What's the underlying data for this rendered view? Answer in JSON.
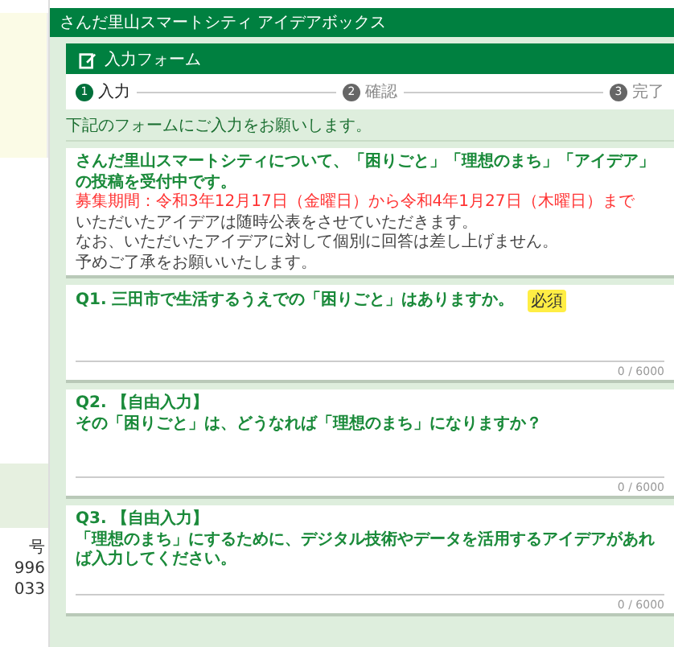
{
  "background_page": {
    "fragments": [
      "号",
      "996",
      "033"
    ]
  },
  "top_bar": {
    "title": "さんだ里山スマートシティ アイデアボックス"
  },
  "form": {
    "title": "入力フォーム",
    "steps": [
      {
        "number": "1",
        "label": "入力",
        "selected": true
      },
      {
        "number": "2",
        "label": "確認",
        "selected": false
      },
      {
        "number": "3",
        "label": "完了",
        "selected": false
      }
    ],
    "notice": "下記のフォームにご入力をお願いします。",
    "intro": {
      "heading": "さんだ里山スマートシティについて、「困りごと」「理想のまち」「アイデア」の投稿を受付中です。",
      "period": "募集期間：令和3年12月17日（金曜日）から令和4年1月27日（木曜日）まで",
      "lines": [
        "いただいたアイデアは随時公表をさせていただきます。",
        "なお、いただいたアイデアに対して個別に回答は差し上げません。",
        "予めご了承をお願いいたします。"
      ]
    },
    "questions": [
      {
        "number": "Q1.",
        "text": "三田市で生活するうえでの「困りごと」はありますか。",
        "badge": "必須",
        "counter": "0 / 6000"
      },
      {
        "number": "Q2.",
        "tag": "【自由入力】",
        "text": "その「困りごと」は、どうなれば「理想のまち」になりますか？",
        "counter": "0 / 6000"
      },
      {
        "number": "Q3.",
        "tag": "【自由入力】",
        "text": "「理想のまち」にするために、デジタル技術やデータを活用するアイデアがあれば入力してください。",
        "counter": "0 / 6000"
      }
    ]
  }
}
